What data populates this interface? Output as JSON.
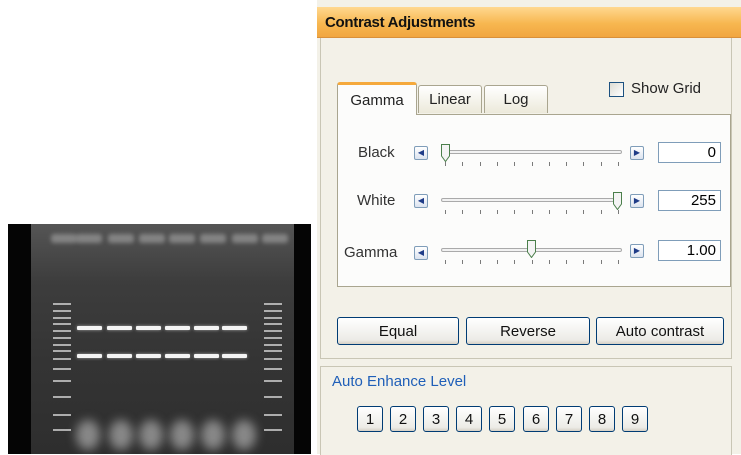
{
  "panel": {
    "title": "Contrast Adjustments"
  },
  "tabs": [
    {
      "label": "Gamma",
      "active": true
    },
    {
      "label": "Linear",
      "active": false
    },
    {
      "label": "Log",
      "active": false
    }
  ],
  "show_grid": {
    "label": "Show Grid",
    "checked": false
  },
  "sliders": [
    {
      "label": "Black",
      "value": "0",
      "min": 0,
      "max": 255,
      "position": 0
    },
    {
      "label": "White",
      "value": "255",
      "min": 0,
      "max": 255,
      "position": 255
    },
    {
      "label": "Gamma",
      "value": "1.00",
      "position_fraction": 0.5
    }
  ],
  "buttons": {
    "equal": "Equal",
    "reverse": "Reverse",
    "auto_contrast": "Auto contrast"
  },
  "auto_enhance": {
    "label": "Auto Enhance Level",
    "levels": [
      "1",
      "2",
      "3",
      "4",
      "5",
      "6",
      "7",
      "8",
      "9"
    ]
  },
  "colors": {
    "header_accent": "#f5a93c",
    "section_label": "#1f5fb8"
  },
  "icons": {
    "left_arrow": "arrow-left-icon",
    "right_arrow": "arrow-right-icon"
  }
}
